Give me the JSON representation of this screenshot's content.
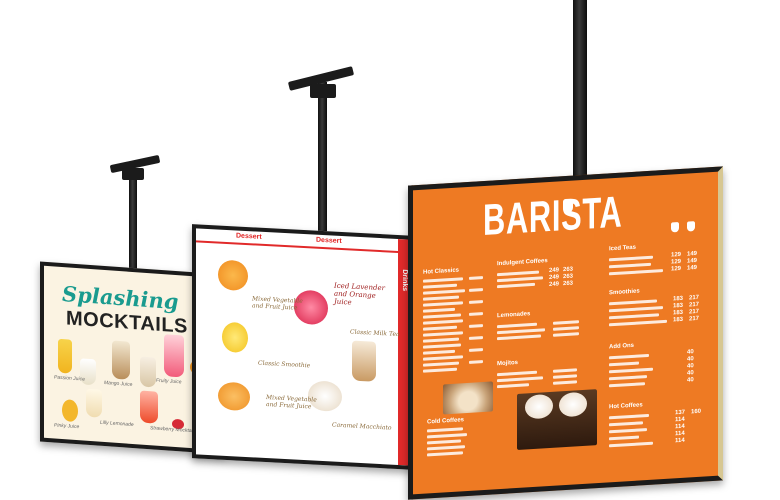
{
  "screens": {
    "left": {
      "title_line1": "Splashing",
      "title_line2": "MOCKTAILS",
      "drinks": [
        "Passion Juice",
        "Mango Juice",
        "Fruity Juice",
        "Lilly Lemonade",
        "Strawberry Mocktail",
        "Pinky Juice"
      ]
    },
    "middle": {
      "header_left": "Dessert",
      "header_right": "Dessert",
      "side_label": "Drinks",
      "items": [
        "Mixed Vegetable and Fruit Juice",
        "Classic Smoothie",
        "Mixed Vegetable and Fruit Juice",
        "Iced Lavender and Orange Juice",
        "Classic Milk Tea",
        "Caramel Macchiato"
      ]
    },
    "right": {
      "title": "BARISTA",
      "sections": {
        "hot_classics": "Hot Classics",
        "indulgent_coffees": "Indulgent Coffees",
        "lemonades": "Lemonades",
        "mojitos": "Mojitos",
        "iced_teas": "Iced Teas",
        "smoothies": "Smoothies",
        "add_ons": "Add Ons",
        "hot_coffees": "Hot Coffees",
        "cold_coffees": "Cold Coffees"
      },
      "prices": {
        "indulgent": [
          "249",
          "263",
          "249",
          "263",
          "249",
          "263"
        ],
        "iced_teas": [
          "129",
          "149",
          "129",
          "149",
          "129",
          "149"
        ],
        "smoothies": [
          "183",
          "217",
          "183",
          "217",
          "183",
          "217",
          "183",
          "217"
        ],
        "add_ons": [
          "40",
          "40",
          "40",
          "40",
          "40"
        ],
        "hot_coffees": [
          "137",
          "160",
          "114",
          "114",
          "114",
          "114"
        ]
      }
    }
  },
  "colors": {
    "orange": "#ee7a23",
    "teal": "#1a9b8f",
    "red": "#e12a2a",
    "frame": "#1b1b1b"
  }
}
